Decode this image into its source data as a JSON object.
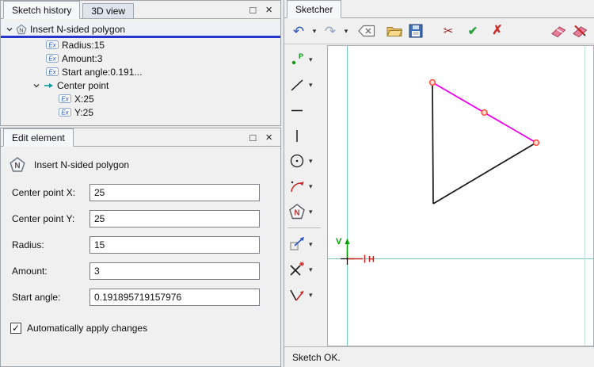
{
  "colors": {
    "selection_underline": "#2636cc",
    "selected_edge_magenta": "#ee00ee",
    "axis_teal": "#76c7b8",
    "vertex_red": "#ff4633",
    "v_axis_green": "#00a000",
    "h_axis_red": "#cc2020",
    "accept_green": "#2e9e3e",
    "cancel_red": "#d22d2d"
  },
  "icons": {
    "maximize": "□",
    "close": "×",
    "dropdown": "▾",
    "undo": "↶",
    "redo": "↷",
    "scissors": "✂",
    "accept": "✔",
    "cancel": "✗",
    "checkmark": "✓",
    "expression_badge": "Ex",
    "polygon_letter": "N"
  },
  "history_panel": {
    "tabs": [
      {
        "label": "Sketch history",
        "active": true
      },
      {
        "label": "3D view",
        "active": false
      }
    ],
    "tree": {
      "root_label": "Insert N-sided polygon",
      "children": [
        {
          "label": "Radius:15"
        },
        {
          "label": "Amount:3"
        },
        {
          "label": "Start angle:0.191..."
        },
        {
          "label": "Center point",
          "children": [
            {
              "label": "X:25"
            },
            {
              "label": "Y:25"
            }
          ]
        }
      ]
    }
  },
  "edit_panel": {
    "tab_label": "Edit element",
    "header": "Insert N-sided polygon",
    "fields": [
      {
        "label": "Center point X:",
        "value": "25"
      },
      {
        "label": "Center point Y:",
        "value": "25"
      },
      {
        "label": "Radius:",
        "value": "15"
      },
      {
        "label": "Amount:",
        "value": "3"
      },
      {
        "label": "Start angle:",
        "value": "0.191895719157976"
      }
    ],
    "auto_apply": {
      "label": "Automatically apply changes",
      "checked": true
    }
  },
  "sketcher": {
    "tab_label": "Sketcher",
    "status": "Sketch OK.",
    "axes": {
      "v_label": "V",
      "h_label": "H"
    }
  }
}
